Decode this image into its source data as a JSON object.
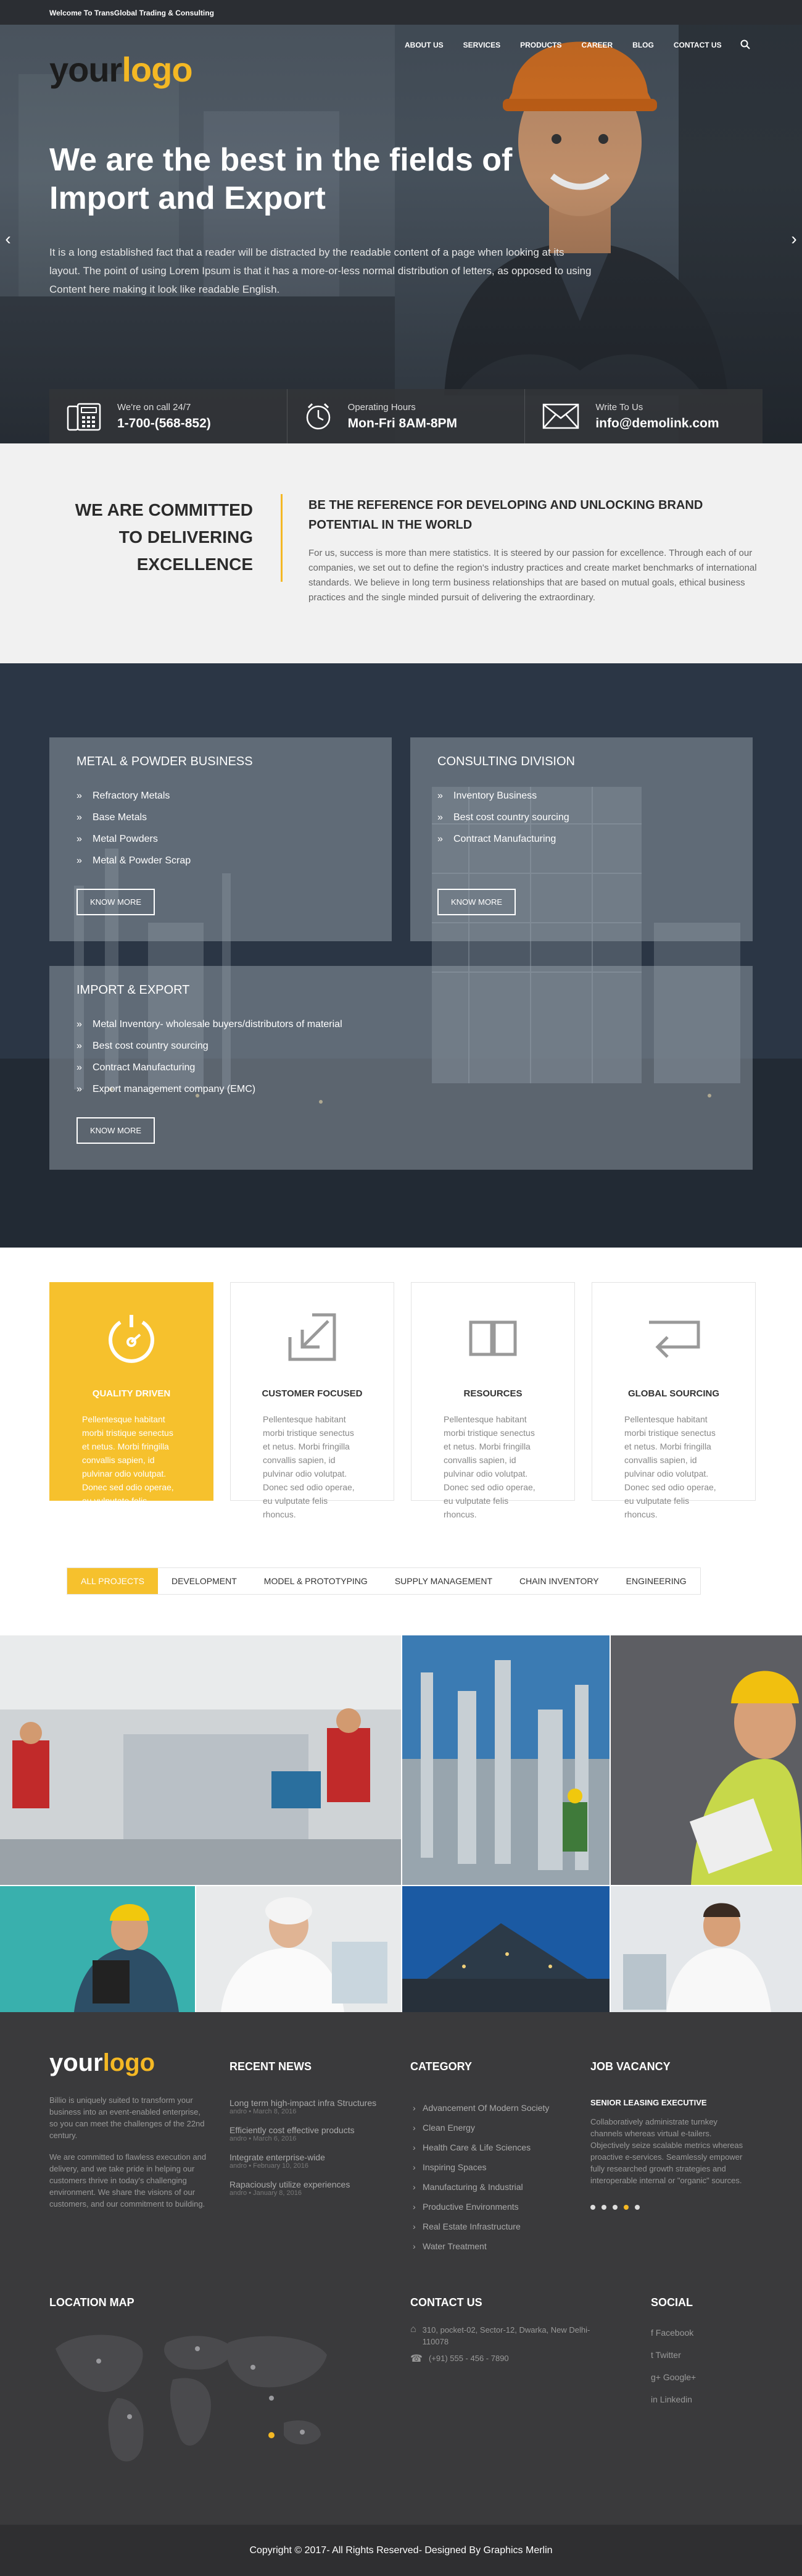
{
  "topbar": {
    "welcome": "Welcome To TransGlobal Trading & Consulting"
  },
  "brand": {
    "logo_a": "your",
    "logo_b": "logo"
  },
  "nav": [
    "ABOUT US",
    "SERVICES",
    "PRODUCTS",
    "CAREER",
    "BLOG",
    "CONTACT US"
  ],
  "hero": {
    "title": "We are the best in the fields of Import and Export",
    "text": "It is a long established fact that a reader will be distracted by the readable content of a page when looking at its layout. The point of using Lorem Ipsum is that it has a more-or-less normal distribution of letters, as opposed to using Content here making it look like readable English."
  },
  "info": [
    {
      "label": "We're on call 24/7",
      "value": "1-700-(568-852)",
      "icon": "phone-icon"
    },
    {
      "label": "Operating Hours",
      "value": "Mon-Fri 8AM-8PM",
      "icon": "clock-icon"
    },
    {
      "label": "Write To Us",
      "value": "info@demolink.com",
      "icon": "mail-icon"
    }
  ],
  "committed": {
    "left": "WE ARE COMMITTED TO DELIVERING EXCELLENCE",
    "title": "BE THE REFERENCE FOR DEVELOPING AND UNLOCKING BRAND POTENTIAL IN THE WORLD",
    "text": "For us, success is more than mere statistics. It is steered by our passion for excellence. Through each of our companies, we set out to define the region's industry practices and create market benchmarks of international standards. We believe in long term business relationships that are based on mutual goals, ethical business practices and the single minded pursuit of delivering the extraordinary."
  },
  "services": [
    {
      "title": "METAL & POWDER BUSINESS",
      "items": [
        "Refractory Metals",
        "Base Metals",
        "Metal Powders",
        "Metal & Powder Scrap"
      ],
      "button": "KNOW MORE"
    },
    {
      "title": "CONSULTING DIVISION",
      "items": [
        "Inventory Business",
        "Best cost country sourcing",
        "Contract Manufacturing"
      ],
      "button": "KNOW MORE"
    },
    {
      "title": "IMPORT & EXPORT",
      "items": [
        "Metal Inventory- wholesale buyers/distributors of material",
        "Best cost country sourcing",
        "Contract Manufacturing",
        "Export management company (EMC)"
      ],
      "button": "KNOW MORE"
    }
  ],
  "features": [
    {
      "title": "QUALITY DRIVEN",
      "text": "Pellentesque habitant morbi tristique senectus et netus. Morbi fringilla convallis sapien, id pulvinar odio volutpat. Donec sed odio operae, eu vulputate felis rhoncus.",
      "icon": "gauge-icon"
    },
    {
      "title": "CUSTOMER FOCUSED",
      "text": "Pellentesque habitant morbi tristique senectus et netus. Morbi fringilla convallis sapien, id pulvinar odio volutpat. Donec sed odio operae, eu vulputate felis rhoncus.",
      "icon": "arrow-down-left-icon"
    },
    {
      "title": "RESOURCES",
      "text": "Pellentesque habitant morbi tristique senectus et netus. Morbi fringilla convallis sapien, id pulvinar odio volutpat. Donec sed odio operae, eu vulputate felis rhoncus.",
      "icon": "book-icon"
    },
    {
      "title": "GLOBAL SOURCING",
      "text": "Pellentesque habitant morbi tristique senectus et netus. Morbi fringilla convallis sapien, id pulvinar odio volutpat. Donec sed odio operae, eu vulputate felis rhoncus.",
      "icon": "return-arrow-icon"
    }
  ],
  "tabs": [
    "ALL PROJECTS",
    "DEVELOPMENT",
    "MODEL & PROTOTYPING",
    "SUPPLY MANAGEMENT",
    "CHAIN INVENTORY",
    "ENGINEERING"
  ],
  "footer": {
    "about_1": "Billio is uniquely suited to transform your business into an event-enabled enterprise, so you can meet the challenges of the 22nd century.",
    "about_2": "We are committed to flawless execution and delivery, and we take pride in helping our customers thrive in today's challenging environment. We share the visions of our customers, and our commitment to building.",
    "news_title": "RECENT NEWS",
    "news": [
      {
        "t": "Long term high-impact infra Structures",
        "d": "andro • March 8, 2016"
      },
      {
        "t": "Efficiently cost effective products",
        "d": "andro • March 6, 2016"
      },
      {
        "t": "Integrate enterprise-wide",
        "d": "andro • February 10, 2016"
      },
      {
        "t": "Rapaciously utilize experiences",
        "d": "andro • January 8, 2016"
      }
    ],
    "cat_title": "CATEGORY",
    "categories": [
      "Advancement Of Modern Society",
      "Clean Energy",
      "Health Care & Life Sciences",
      "Inspiring Spaces",
      "Manufacturing & Industrial",
      "Productive Environments",
      "Real Estate Infrastructure",
      "Water Treatment"
    ],
    "job_title": "JOB VACANCY",
    "job_sub": "SENIOR LEASING EXECUTIVE",
    "job_text": "Collaboratively administrate turnkey channels whereas virtual e-tailers. Objectively seize scalable metrics whereas proactive e-services. Seamlessly empower fully researched growth strategies and interoperable internal or \"organic\" sources.",
    "map_title": "LOCATION MAP",
    "contact_title": "CONTACT US",
    "contact_addr": "310, pocket-02, Sector-12, Dwarka, New Delhi-110078",
    "contact_phone": "(+91) 555 - 456 - 7890",
    "social_title": "SOCIAL",
    "social": [
      "Facebook",
      "Twitter",
      "Google+",
      "Linkedin"
    ]
  },
  "copyright": "Copyright © 2017- All Rights Reserved- Designed By Graphics Merlin",
  "colors": {
    "accent": "#f4b824",
    "dark": "#3a3a3c"
  }
}
